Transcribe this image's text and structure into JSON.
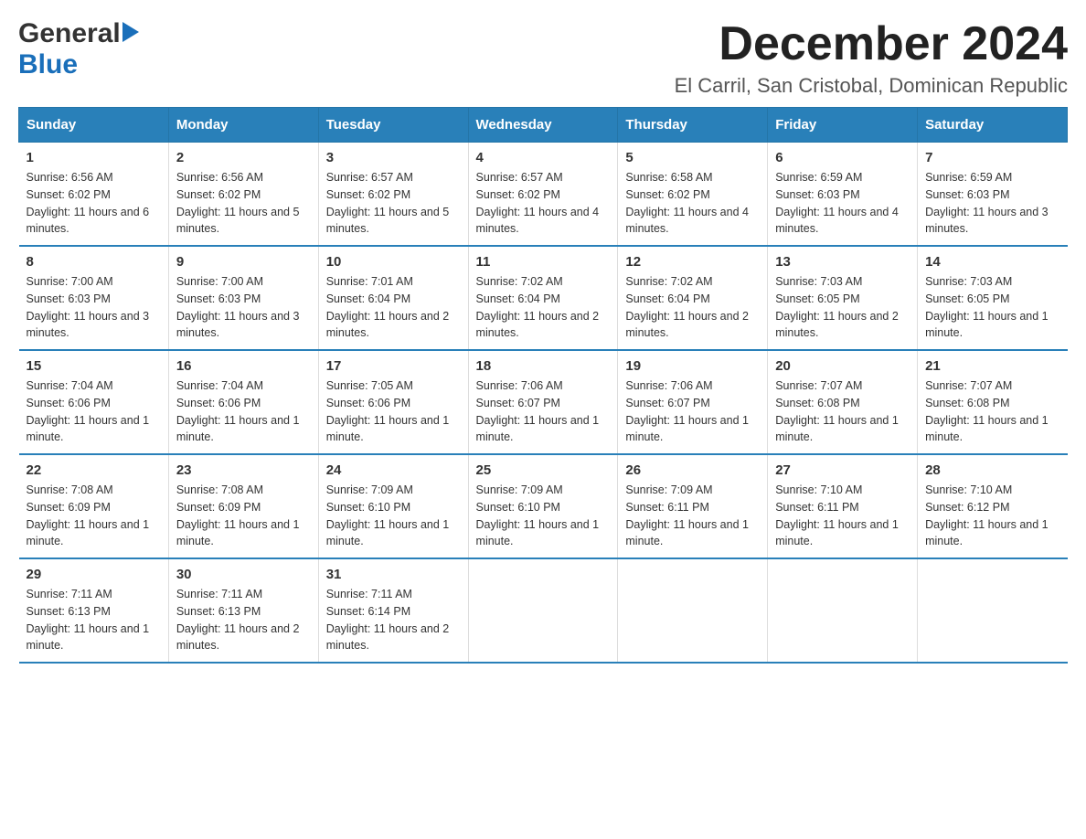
{
  "logo": {
    "general": "General",
    "blue": "Blue",
    "arrow": "▶"
  },
  "title": "December 2024",
  "location": "El Carril, San Cristobal, Dominican Republic",
  "days_of_week": [
    "Sunday",
    "Monday",
    "Tuesday",
    "Wednesday",
    "Thursday",
    "Friday",
    "Saturday"
  ],
  "weeks": [
    [
      {
        "day": "1",
        "sunrise": "Sunrise: 6:56 AM",
        "sunset": "Sunset: 6:02 PM",
        "daylight": "Daylight: 11 hours and 6 minutes."
      },
      {
        "day": "2",
        "sunrise": "Sunrise: 6:56 AM",
        "sunset": "Sunset: 6:02 PM",
        "daylight": "Daylight: 11 hours and 5 minutes."
      },
      {
        "day": "3",
        "sunrise": "Sunrise: 6:57 AM",
        "sunset": "Sunset: 6:02 PM",
        "daylight": "Daylight: 11 hours and 5 minutes."
      },
      {
        "day": "4",
        "sunrise": "Sunrise: 6:57 AM",
        "sunset": "Sunset: 6:02 PM",
        "daylight": "Daylight: 11 hours and 4 minutes."
      },
      {
        "day": "5",
        "sunrise": "Sunrise: 6:58 AM",
        "sunset": "Sunset: 6:02 PM",
        "daylight": "Daylight: 11 hours and 4 minutes."
      },
      {
        "day": "6",
        "sunrise": "Sunrise: 6:59 AM",
        "sunset": "Sunset: 6:03 PM",
        "daylight": "Daylight: 11 hours and 4 minutes."
      },
      {
        "day": "7",
        "sunrise": "Sunrise: 6:59 AM",
        "sunset": "Sunset: 6:03 PM",
        "daylight": "Daylight: 11 hours and 3 minutes."
      }
    ],
    [
      {
        "day": "8",
        "sunrise": "Sunrise: 7:00 AM",
        "sunset": "Sunset: 6:03 PM",
        "daylight": "Daylight: 11 hours and 3 minutes."
      },
      {
        "day": "9",
        "sunrise": "Sunrise: 7:00 AM",
        "sunset": "Sunset: 6:03 PM",
        "daylight": "Daylight: 11 hours and 3 minutes."
      },
      {
        "day": "10",
        "sunrise": "Sunrise: 7:01 AM",
        "sunset": "Sunset: 6:04 PM",
        "daylight": "Daylight: 11 hours and 2 minutes."
      },
      {
        "day": "11",
        "sunrise": "Sunrise: 7:02 AM",
        "sunset": "Sunset: 6:04 PM",
        "daylight": "Daylight: 11 hours and 2 minutes."
      },
      {
        "day": "12",
        "sunrise": "Sunrise: 7:02 AM",
        "sunset": "Sunset: 6:04 PM",
        "daylight": "Daylight: 11 hours and 2 minutes."
      },
      {
        "day": "13",
        "sunrise": "Sunrise: 7:03 AM",
        "sunset": "Sunset: 6:05 PM",
        "daylight": "Daylight: 11 hours and 2 minutes."
      },
      {
        "day": "14",
        "sunrise": "Sunrise: 7:03 AM",
        "sunset": "Sunset: 6:05 PM",
        "daylight": "Daylight: 11 hours and 1 minute."
      }
    ],
    [
      {
        "day": "15",
        "sunrise": "Sunrise: 7:04 AM",
        "sunset": "Sunset: 6:06 PM",
        "daylight": "Daylight: 11 hours and 1 minute."
      },
      {
        "day": "16",
        "sunrise": "Sunrise: 7:04 AM",
        "sunset": "Sunset: 6:06 PM",
        "daylight": "Daylight: 11 hours and 1 minute."
      },
      {
        "day": "17",
        "sunrise": "Sunrise: 7:05 AM",
        "sunset": "Sunset: 6:06 PM",
        "daylight": "Daylight: 11 hours and 1 minute."
      },
      {
        "day": "18",
        "sunrise": "Sunrise: 7:06 AM",
        "sunset": "Sunset: 6:07 PM",
        "daylight": "Daylight: 11 hours and 1 minute."
      },
      {
        "day": "19",
        "sunrise": "Sunrise: 7:06 AM",
        "sunset": "Sunset: 6:07 PM",
        "daylight": "Daylight: 11 hours and 1 minute."
      },
      {
        "day": "20",
        "sunrise": "Sunrise: 7:07 AM",
        "sunset": "Sunset: 6:08 PM",
        "daylight": "Daylight: 11 hours and 1 minute."
      },
      {
        "day": "21",
        "sunrise": "Sunrise: 7:07 AM",
        "sunset": "Sunset: 6:08 PM",
        "daylight": "Daylight: 11 hours and 1 minute."
      }
    ],
    [
      {
        "day": "22",
        "sunrise": "Sunrise: 7:08 AM",
        "sunset": "Sunset: 6:09 PM",
        "daylight": "Daylight: 11 hours and 1 minute."
      },
      {
        "day": "23",
        "sunrise": "Sunrise: 7:08 AM",
        "sunset": "Sunset: 6:09 PM",
        "daylight": "Daylight: 11 hours and 1 minute."
      },
      {
        "day": "24",
        "sunrise": "Sunrise: 7:09 AM",
        "sunset": "Sunset: 6:10 PM",
        "daylight": "Daylight: 11 hours and 1 minute."
      },
      {
        "day": "25",
        "sunrise": "Sunrise: 7:09 AM",
        "sunset": "Sunset: 6:10 PM",
        "daylight": "Daylight: 11 hours and 1 minute."
      },
      {
        "day": "26",
        "sunrise": "Sunrise: 7:09 AM",
        "sunset": "Sunset: 6:11 PM",
        "daylight": "Daylight: 11 hours and 1 minute."
      },
      {
        "day": "27",
        "sunrise": "Sunrise: 7:10 AM",
        "sunset": "Sunset: 6:11 PM",
        "daylight": "Daylight: 11 hours and 1 minute."
      },
      {
        "day": "28",
        "sunrise": "Sunrise: 7:10 AM",
        "sunset": "Sunset: 6:12 PM",
        "daylight": "Daylight: 11 hours and 1 minute."
      }
    ],
    [
      {
        "day": "29",
        "sunrise": "Sunrise: 7:11 AM",
        "sunset": "Sunset: 6:13 PM",
        "daylight": "Daylight: 11 hours and 1 minute."
      },
      {
        "day": "30",
        "sunrise": "Sunrise: 7:11 AM",
        "sunset": "Sunset: 6:13 PM",
        "daylight": "Daylight: 11 hours and 2 minutes."
      },
      {
        "day": "31",
        "sunrise": "Sunrise: 7:11 AM",
        "sunset": "Sunset: 6:14 PM",
        "daylight": "Daylight: 11 hours and 2 minutes."
      },
      null,
      null,
      null,
      null
    ]
  ]
}
